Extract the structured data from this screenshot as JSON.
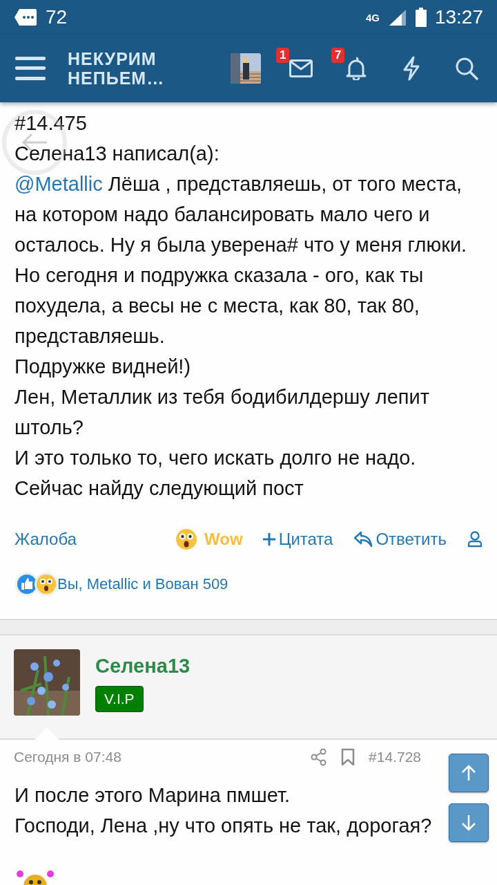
{
  "status_bar": {
    "notification_count": "72",
    "network": "4G",
    "time": "13:27"
  },
  "header": {
    "logo_lines": [
      "НЕКУРИМ",
      "НЕПЬЕМ…"
    ],
    "messages_badge": "1",
    "alerts_badge": "7"
  },
  "post_top": {
    "post_number": "#14.475",
    "quote_author": "Селена13 написал(а):",
    "mention": "@Metallic",
    "first_line": " Лёша , представляешь, от того места, на котором надо балансировать мало чего и осталось. Ну я была уверена# что у меня глюки. Но сегодня и подружка сказала - ого, как ты похудела, а весы не с места, как 80, так 80, представляешь.",
    "lines": [
      "Подружке видней!)",
      "Лен, Металлик из тебя бодибилдершу лепит штоль?",
      "И это только то, чего искать долго не надо.",
      "Сейчас найду следующий пост"
    ]
  },
  "actions": {
    "report": "Жалоба",
    "reaction": "Wow",
    "quote": "Цитата",
    "reply": "Ответить"
  },
  "reactions_summary": "Вы, Metallic и Вован 509",
  "next_post": {
    "author": "Селена13",
    "badge": "V.I.P",
    "date": "Сегодня в 07:48",
    "post_number": "#14.728",
    "lines": [
      "И после этого Марина пмшет.",
      "Господи, Лена ,ну что опять не так, дорогая?"
    ]
  }
}
